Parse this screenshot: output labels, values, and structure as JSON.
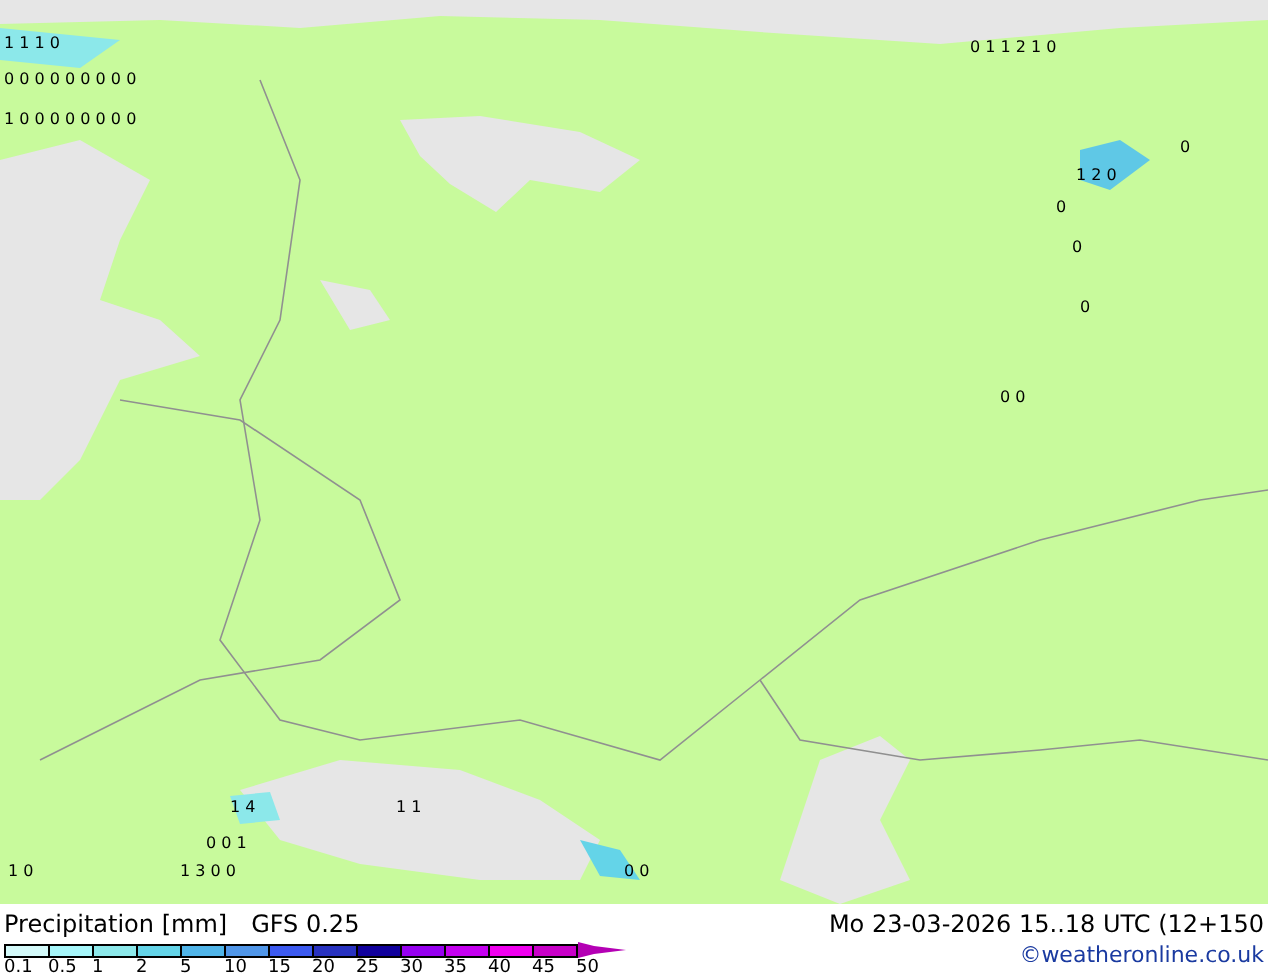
{
  "map_labels": [
    "1 1 1 0",
    "0 1 1 2 1 0",
    "0 0 0 0 0 0 0 0 0",
    "1 0 0 0 0 0 0 0 0",
    "0",
    "1 2 0",
    "0",
    "0",
    "0",
    "0 0",
    "1 4",
    "1 1",
    "0 0 1",
    "1 0",
    "1 3 0 0",
    "0 0"
  ],
  "legend": {
    "title": "Precipitation [mm]",
    "model": "GFS 0.25",
    "scale": [
      {
        "label": "0.1",
        "color": "#d4fafa"
      },
      {
        "label": "0.5",
        "color": "#a6f6fa"
      },
      {
        "label": "1",
        "color": "#8ce8ea"
      },
      {
        "label": "2",
        "color": "#64d4e8"
      },
      {
        "label": "5",
        "color": "#50b4e8"
      },
      {
        "label": "10",
        "color": "#5096e8"
      },
      {
        "label": "15",
        "color": "#3c5af0"
      },
      {
        "label": "20",
        "color": "#2832c0"
      },
      {
        "label": "25",
        "color": "#10009c"
      },
      {
        "label": "30",
        "color": "#9600f0"
      },
      {
        "label": "35",
        "color": "#c400f0"
      },
      {
        "label": "40",
        "color": "#f000f0"
      },
      {
        "label": "45",
        "color": "#c800c8"
      }
    ],
    "end_label": "50",
    "end_marker": {
      "color": "#b400b4"
    }
  },
  "valid_time": "Mo 23-03-2026 15..18 UTC (12+150",
  "credit": "©weatheronline.co.uk"
}
